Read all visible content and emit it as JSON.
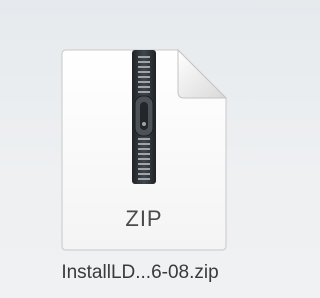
{
  "file": {
    "icon": "zip-archive-icon",
    "type_label": "ZIP",
    "name": "InstallLD...6-08.zip"
  },
  "colors": {
    "background": "#eceef0",
    "page": "#fbfbfb",
    "zipper": "#2e3338",
    "text": "#3a3a3a"
  }
}
